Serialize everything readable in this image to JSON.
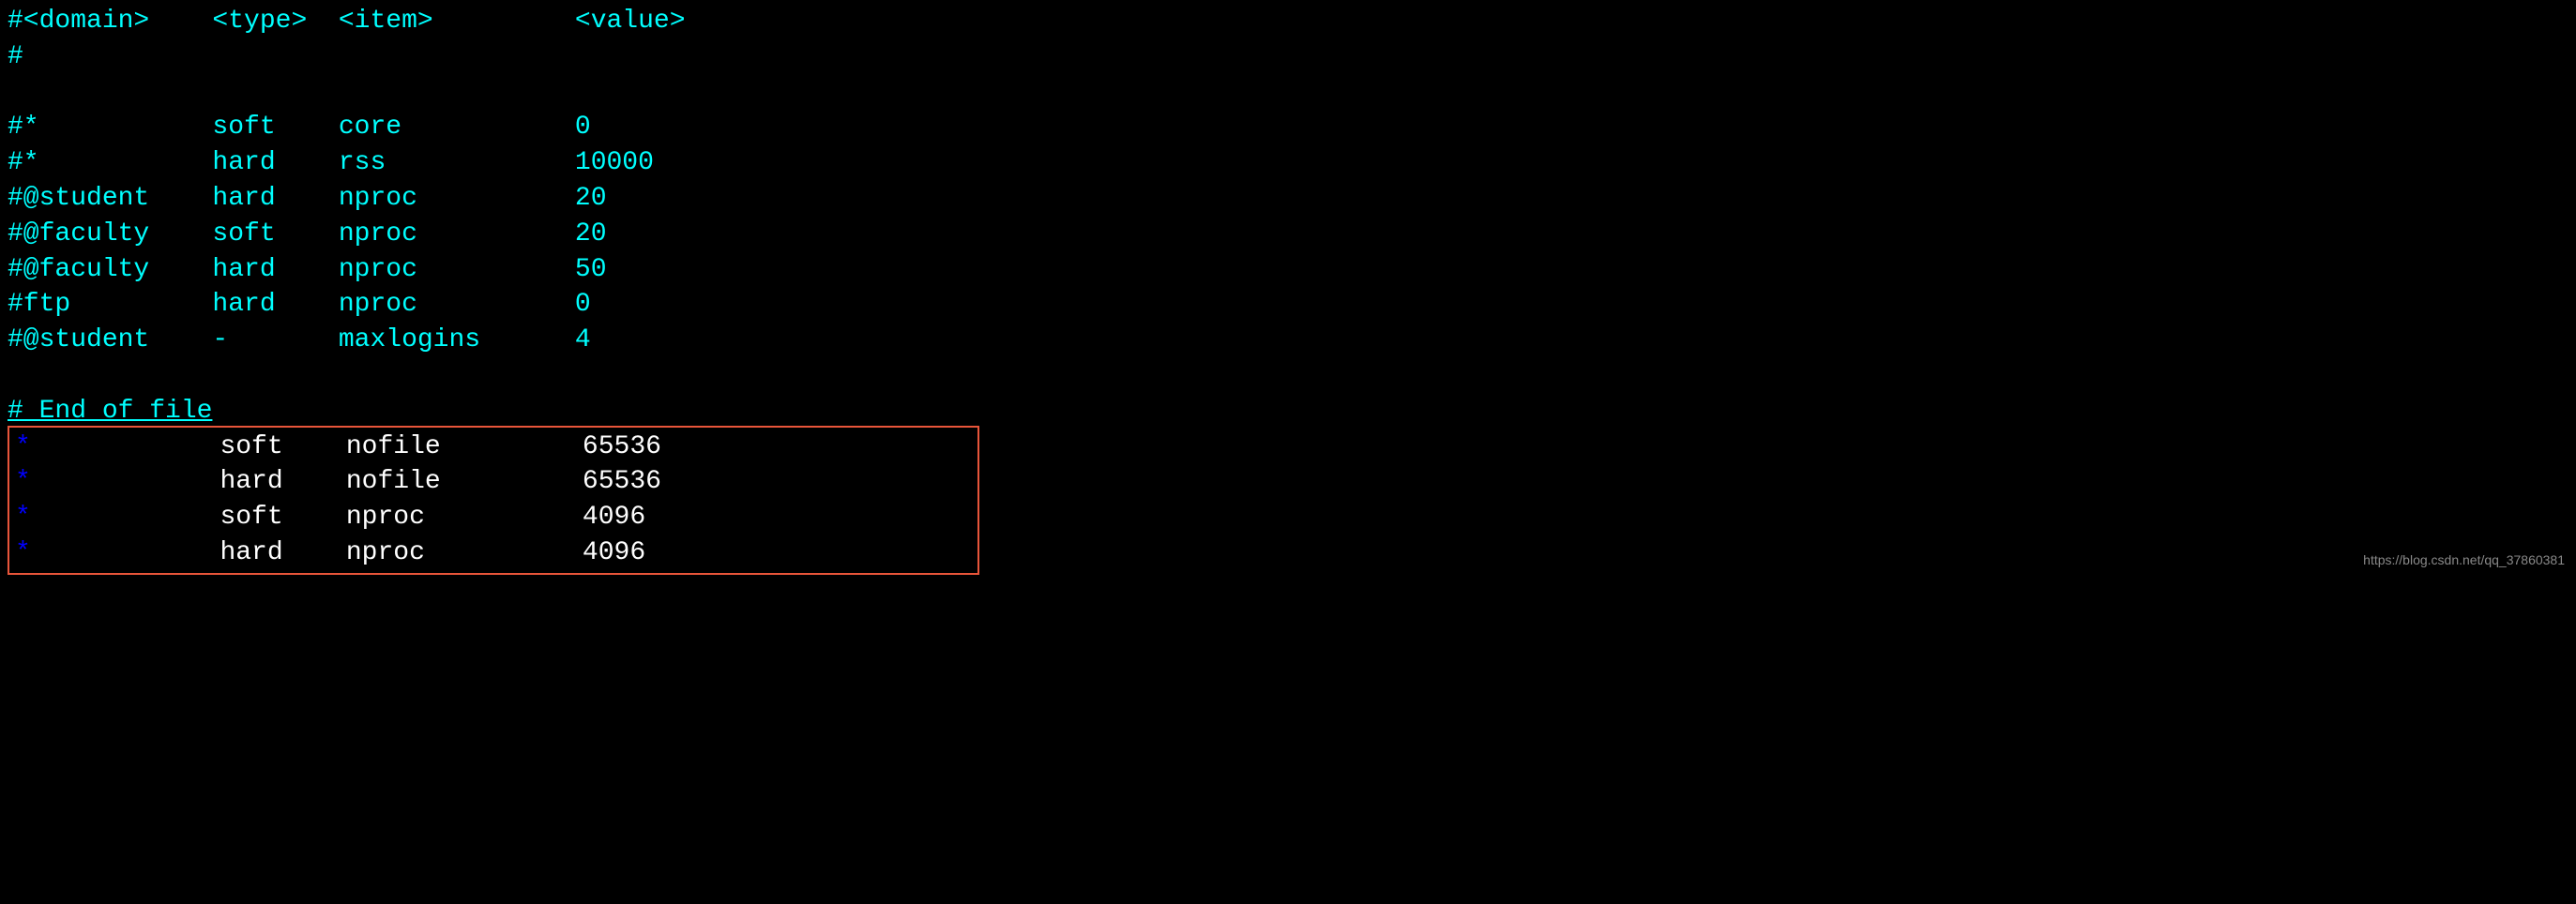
{
  "header": {
    "domain_label": "#<domain>",
    "type_label": "<type>",
    "item_label": "<item>",
    "value_label": "<value>"
  },
  "hash_line": "#",
  "commented_rows": [
    {
      "domain": "#*",
      "type": "soft",
      "item": "core",
      "value": "0"
    },
    {
      "domain": "#*",
      "type": "hard",
      "item": "rss",
      "value": "10000"
    },
    {
      "domain": "#@student",
      "type": "hard",
      "item": "nproc",
      "value": "20"
    },
    {
      "domain": "#@faculty",
      "type": "soft",
      "item": "nproc",
      "value": "20"
    },
    {
      "domain": "#@faculty",
      "type": "hard",
      "item": "nproc",
      "value": "50"
    },
    {
      "domain": "#ftp",
      "type": "hard",
      "item": "nproc",
      "value": "0"
    },
    {
      "domain": "#@student",
      "type": "-",
      "item": "maxlogins",
      "value": "4"
    }
  ],
  "end_of_file": "# End of file",
  "added_rows": [
    {
      "domain": "*",
      "type": "soft",
      "item": "nofile",
      "value": "65536"
    },
    {
      "domain": "*",
      "type": "hard",
      "item": "nofile",
      "value": "65536"
    },
    {
      "domain": "*",
      "type": "soft",
      "item": "nproc",
      "value": "4096"
    },
    {
      "domain": "*",
      "type": "hard",
      "item": "nproc",
      "value": "4096"
    }
  ],
  "watermark": "https://blog.csdn.net/qq_37860381",
  "columns": {
    "domain_width": 13,
    "type_width": 8,
    "item_width": 15
  }
}
